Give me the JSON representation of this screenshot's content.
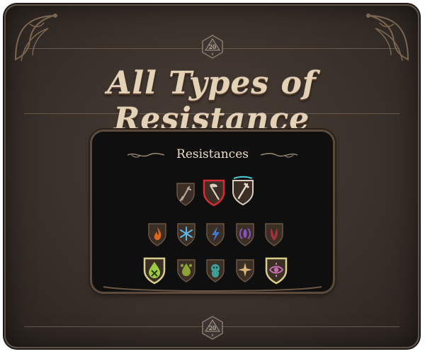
{
  "page": {
    "title": "All Types of Resistance",
    "die_face_top": "20",
    "die_face_bottom": "20"
  },
  "panel": {
    "heading": "Resistances"
  },
  "resistances": {
    "physical": [
      {
        "name": "piercing-icon",
        "state": "normal"
      },
      {
        "name": "slashing-icon",
        "state": "active-red"
      },
      {
        "name": "bludgeoning-icon",
        "state": "active-teal"
      }
    ],
    "elemental": [
      {
        "name": "fire-icon",
        "color": "#d8661e"
      },
      {
        "name": "cold-icon",
        "color": "#5db7e6"
      },
      {
        "name": "lightning-icon",
        "color": "#3f79c7"
      },
      {
        "name": "thunder-icon",
        "color": "#8a54c8"
      },
      {
        "name": "necrotic-icon",
        "color": "#a7313a"
      }
    ],
    "other": [
      {
        "name": "poison-icon",
        "color": "#9ccc44",
        "state": "highlighted"
      },
      {
        "name": "acid-icon",
        "color": "#8ea335"
      },
      {
        "name": "psychic-icon",
        "color": "#3f9f96"
      },
      {
        "name": "radiant-icon",
        "color": "#d7b27a"
      },
      {
        "name": "force-icon",
        "color": "#c56fb0",
        "state": "highlighted"
      }
    ]
  },
  "colors": {
    "shield_fill": "#3a2e25",
    "shield_border": "#6a5644",
    "active_red": "#d72a34",
    "active_teal": "#4fd0d4",
    "highlight_gold": "#d8cd8a"
  }
}
